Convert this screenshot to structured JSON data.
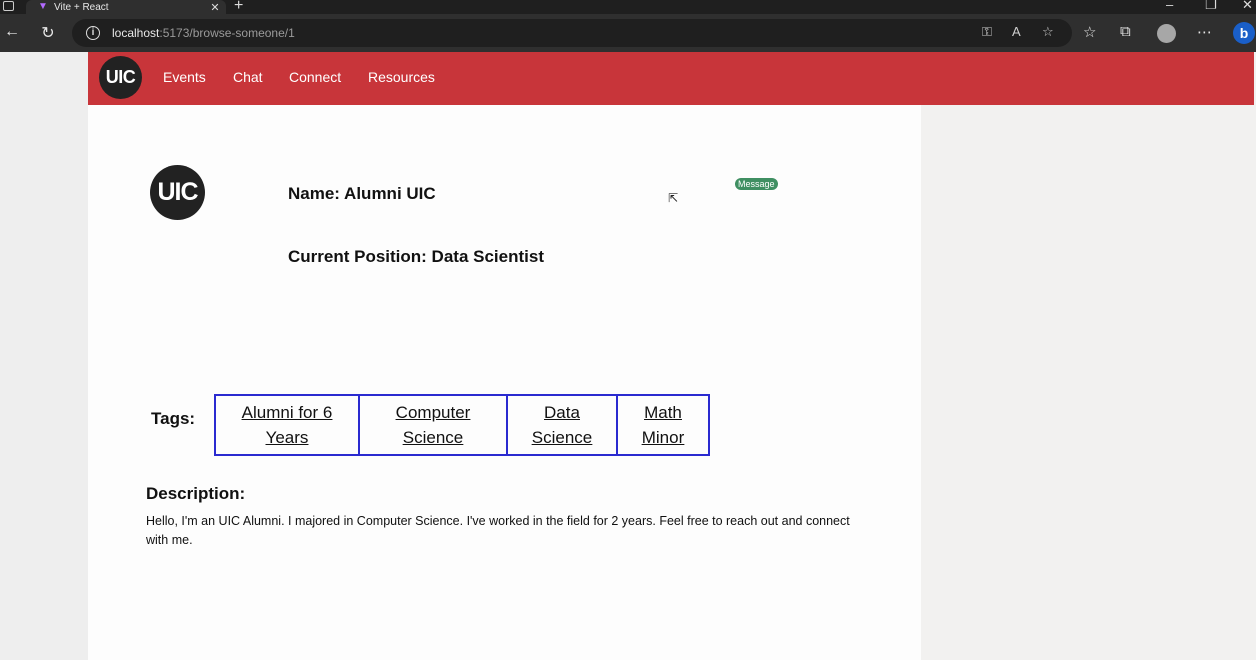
{
  "browser": {
    "tab_title": "Vite + React",
    "url_host": "localhost",
    "url_path": ":5173/browse-someone/1",
    "new_tab": "+",
    "tab_close": "✕",
    "bing": "b"
  },
  "navbar": {
    "logo": "UIC",
    "links": [
      "Events",
      "Chat",
      "Connect",
      "Resources"
    ]
  },
  "profile": {
    "avatar": "UIC",
    "name": "Name: Alumni UIC",
    "position": "Current Position: Data Scientist",
    "message_label": "Message"
  },
  "tags": {
    "label": "Tags:",
    "items": [
      {
        "line1": "Alumni for 6",
        "line2": "Years"
      },
      {
        "line1": "Computer",
        "line2": "Science"
      },
      {
        "line1": "Data",
        "line2": "Science"
      },
      {
        "line1": "Math",
        "line2": "Minor"
      }
    ]
  },
  "description": {
    "title": "Description:",
    "text": "Hello, I'm an UIC Alumni. I majored in Computer Science. I've worked in the field for 2 years. Feel free to reach out and connect with me."
  }
}
